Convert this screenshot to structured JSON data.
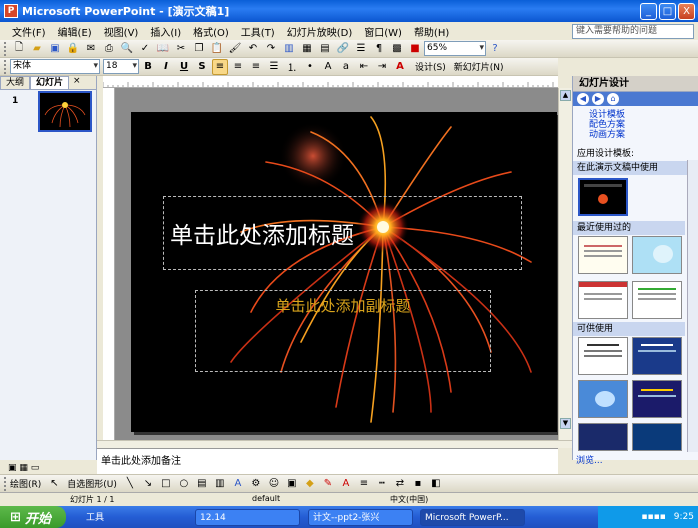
{
  "window": {
    "title": "Microsoft PowerPoint - [演示文稿1]",
    "min_glyph": "_",
    "max_glyph": "□",
    "close_glyph": "X"
  },
  "menu": [
    "文件(F)",
    "编辑(E)",
    "视图(V)",
    "插入(I)",
    "格式(O)",
    "工具(T)",
    "幻灯片放映(D)",
    "窗口(W)",
    "帮助(H)"
  ],
  "help_box": "键入需要帮助的问题",
  "toolbar": {
    "zoom": "65%",
    "font_name": "宋体",
    "font_size": "18",
    "bold": "B",
    "italic": "I",
    "underline": "U",
    "shadow": "S",
    "design_label": "设计(S)",
    "new_slide_label": "新幻灯片(N)"
  },
  "left_pane": {
    "tabs": [
      "大纲",
      "幻灯片"
    ],
    "close_glyph": "×",
    "slide_number": "1"
  },
  "slide": {
    "title_placeholder": "单击此处添加标题",
    "subtitle_placeholder": "单击此处添加副标题"
  },
  "notes_placeholder": "单击此处添加备注",
  "task_pane": {
    "title": "幻灯片设计",
    "links": [
      "设计模板",
      "配色方案",
      "动画方案"
    ],
    "apply_label": "应用设计模板:",
    "sections": [
      "在此演示文稿中使用",
      "最近使用过的",
      "可供使用"
    ],
    "browse_label": "浏览..."
  },
  "drawing_toolbar": {
    "draw_label": "绘图(R)",
    "autoshapes_label": "自选图形(U)"
  },
  "status": {
    "slide_info": "幻灯片 1 / 1",
    "design_name": "default",
    "language": "中文(中国)"
  },
  "taskbar": {
    "start": "开始",
    "quick_label": "工具",
    "items": [
      "12.14",
      "计文--ppt2-张兴",
      "Microsoft PowerP..."
    ],
    "time": "9:25"
  },
  "colors": {
    "accent": "#2b56c7",
    "slide_bg": "#000000",
    "subtitle_text": "#d9a41c"
  }
}
